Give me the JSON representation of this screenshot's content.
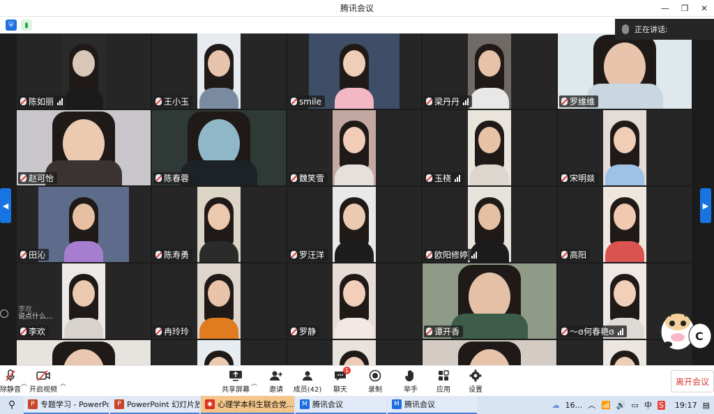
{
  "window": {
    "title": "腾讯会议",
    "minimize": "—",
    "maximize": "❐",
    "close": "✕"
  },
  "speaking": {
    "label": "正在讲话:"
  },
  "participants": [
    {
      "name": "陈如丽",
      "bars": true,
      "bg": "#2a2a2a",
      "fg": "#d9c7b8",
      "cloth": "#1b1b1b",
      "layout": "narrow"
    },
    {
      "name": "王小玉",
      "bars": false,
      "bg": "#e7ebef",
      "fg": "#e7c4ab",
      "cloth": "#7a8aa0",
      "layout": "narrow"
    },
    {
      "name": "smile",
      "bars": false,
      "bg": "#3d4e66",
      "fg": "#f0cdb6",
      "cloth": "#f3b7c5",
      "layout": "half"
    },
    {
      "name": "梁丹丹",
      "bars": true,
      "bg": "#6f6a66",
      "fg": "#e6c2a8",
      "cloth": "#e8e8e8",
      "layout": "narrow"
    },
    {
      "name": "罗维维",
      "bars": false,
      "bg": "#dfe8ec",
      "fg": "#e8c4ad",
      "cloth": "#c9d7e0",
      "layout": "wide"
    },
    {
      "name": "赵可怡",
      "bars": false,
      "bg": "#c9c7cc",
      "fg": "#ecc9b1",
      "cloth": "#3a3331",
      "layout": "wide"
    },
    {
      "name": "陈春蓉",
      "bars": false,
      "bg": "#2f3a36",
      "fg": "#8fb7c7",
      "cloth": "#1c2226",
      "layout": "wide"
    },
    {
      "name": "魏笑雪",
      "bars": false,
      "bg": "#c2a8a0",
      "fg": "#f1cdb8",
      "cloth": "#e6e0dc",
      "layout": "narrow"
    },
    {
      "name": "玉桡",
      "bars": true,
      "bg": "#e9e4dc",
      "fg": "#e7c2a6",
      "cloth": "#ddd6cf",
      "layout": "narrow"
    },
    {
      "name": "宋明燚",
      "bars": false,
      "bg": "#e4dcd8",
      "fg": "#f0cdb5",
      "cloth": "#9dc2e6",
      "layout": "narrow"
    },
    {
      "name": "田沁",
      "bars": false,
      "bg": "#5c6c8a",
      "fg": "#e7c0a4",
      "cloth": "#a77ecf",
      "layout": "half"
    },
    {
      "name": "陈寿勇",
      "bars": false,
      "bg": "#dcd4c6",
      "fg": "#ecc8af",
      "cloth": "#2b2b2b",
      "layout": "narrow"
    },
    {
      "name": "罗汪洋",
      "bars": false,
      "bg": "#e9e9ea",
      "fg": "#ecc9b1",
      "cloth": "#1d1d1d",
      "layout": "narrow"
    },
    {
      "name": "欧阳修婷",
      "bars": true,
      "bg": "#e6e2dc",
      "fg": "#e5c0a5",
      "cloth": "#1b1b1b",
      "layout": "narrow"
    },
    {
      "name": "高阳",
      "bars": false,
      "bg": "#efe7de",
      "fg": "#f0c9b0",
      "cloth": "#d9534f",
      "layout": "narrow"
    },
    {
      "name": "李欢",
      "bars": false,
      "bg": "#ece9e6",
      "fg": "#ecc9b1",
      "cloth": "#d8d3ce",
      "layout": "narrow"
    },
    {
      "name": "冉玲玲",
      "bars": false,
      "bg": "#ded6cc",
      "fg": "#e9c4aa",
      "cloth": "#e07b1f",
      "layout": "narrow"
    },
    {
      "name": "罗静",
      "bars": false,
      "bg": "#e8dcd6",
      "fg": "#f2cfba",
      "cloth": "#f3e8e6",
      "layout": "narrow"
    },
    {
      "name": "谭开香",
      "bars": false,
      "bg": "#8f9b86",
      "fg": "#e4c1a6",
      "cloth": "#3e5c4a",
      "layout": "wide"
    },
    {
      "name": "～ɞ何春艳ɞ",
      "bars": true,
      "bg": "#eee9e4",
      "fg": "#f1cfb9",
      "cloth": "#dedad6",
      "layout": "narrow"
    },
    {
      "name": "",
      "bars": false,
      "bg": "#e7e3df",
      "fg": "#e9c7b0",
      "cloth": "#f1f1f1",
      "layout": "wide"
    },
    {
      "name": "",
      "bars": false,
      "bg": "#e6ecef",
      "fg": "#ecc9b1",
      "cloth": "#2b2b2b",
      "layout": "narrow"
    },
    {
      "name": "",
      "bars": false,
      "bg": "#eae3dd",
      "fg": "#efccb7",
      "cloth": "#f1ece9",
      "layout": "narrow"
    },
    {
      "name": "",
      "bars": false,
      "bg": "#d4cbc4",
      "fg": "#e6c3aa",
      "cloth": "#c8b9ad",
      "layout": "wide"
    },
    {
      "name": "",
      "bars": false,
      "bg": "#ece6e0",
      "fg": "#f0cdb6",
      "cloth": "#efe9e4",
      "layout": "narrow"
    }
  ],
  "chat_overlay": {
    "line1": "李欢",
    "line2": "说点什么..."
  },
  "sticker": {
    "letter": "C"
  },
  "toolbar": {
    "mute": "除静音",
    "video": "开启视频",
    "share": "共享屏幕",
    "invite": "邀请",
    "members": "成员(42)",
    "chat": "聊天",
    "chat_badge": "1",
    "record": "录制",
    "raise": "举手",
    "apps": "应用",
    "settings": "设置",
    "leave": "离开会议"
  },
  "taskbar": {
    "items": [
      {
        "label": "专题学习 - PowerPoint",
        "icon": "P",
        "color": "#c8462b",
        "active": false
      },
      {
        "label": "PowerPoint 幻灯片放...",
        "icon": "P",
        "color": "#c8462b",
        "active": false
      },
      {
        "label": "心理学本科生联合党...",
        "icon": "◉",
        "color": "#d9301f",
        "active": true
      },
      {
        "label": "腾讯会议",
        "icon": "M",
        "color": "#1a6fe0",
        "active": false
      },
      {
        "label": "腾讯会议",
        "icon": "M",
        "color": "#1a6fe0",
        "active": false
      }
    ],
    "weather": "16...",
    "time": "19:17"
  }
}
